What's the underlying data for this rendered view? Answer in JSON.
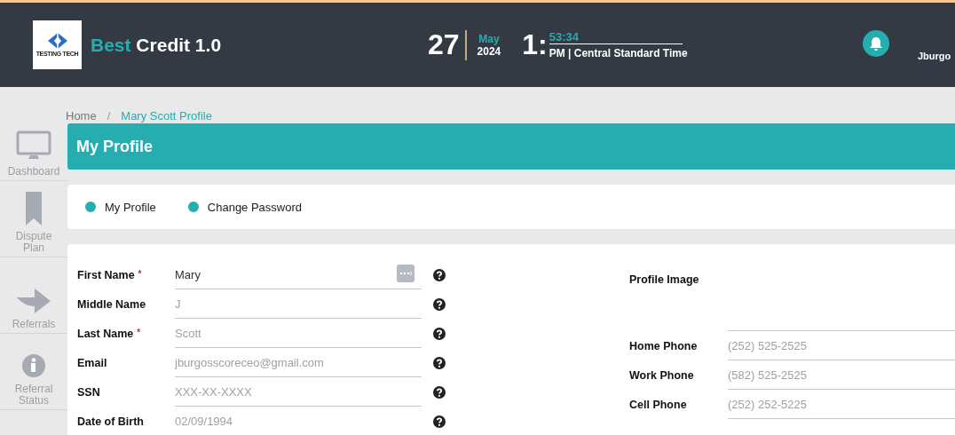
{
  "header": {
    "brand_prefix": "Best",
    "brand_suffix": "Credit 1.0",
    "logo_text": "TESTING TECH",
    "day": "27",
    "month": "May",
    "year": "2024",
    "hour": "1:",
    "minutes": "53:34",
    "zone": "PM | Central Standard Time",
    "user": "Jburgo"
  },
  "sidebar": {
    "items": [
      {
        "label": "Dashboard"
      },
      {
        "label": "Dispute Plan"
      },
      {
        "label": "Referrals"
      },
      {
        "label": "Referral Status"
      }
    ]
  },
  "breadcrumb": {
    "separator": "/",
    "items": [
      {
        "label": "Home",
        "selected": false
      },
      {
        "label": "Mary Scott Profile",
        "selected": true
      }
    ]
  },
  "page_title": "My Profile",
  "tabs": [
    {
      "label": "My Profile"
    },
    {
      "label": "Change Password"
    }
  ],
  "form": {
    "left": [
      {
        "label": "First Name",
        "required_mark": "*",
        "value": "Mary",
        "menu": true
      },
      {
        "label": "Middle Name",
        "placeholder": "J",
        "menu": false
      },
      {
        "label": "Last Name",
        "required_mark": "*",
        "placeholder": "Scott",
        "menu": false
      },
      {
        "label": "Email",
        "placeholder": "jburgosscoreceo@gmail.com",
        "menu": false
      },
      {
        "label": "SSN",
        "placeholder": "XXX-XX-XXXX",
        "menu": false
      },
      {
        "label": "Date of Birth",
        "placeholder": "02/09/1994",
        "menu": false
      }
    ],
    "profile_image_label": "Profile Image",
    "right": [
      {
        "label": "Home Phone",
        "placeholder": "(252) 525-2525"
      },
      {
        "label": "Work Phone",
        "placeholder": "(582) 525-2525"
      },
      {
        "label": "Cell Phone",
        "placeholder": "(252) 252-5225"
      }
    ]
  }
}
